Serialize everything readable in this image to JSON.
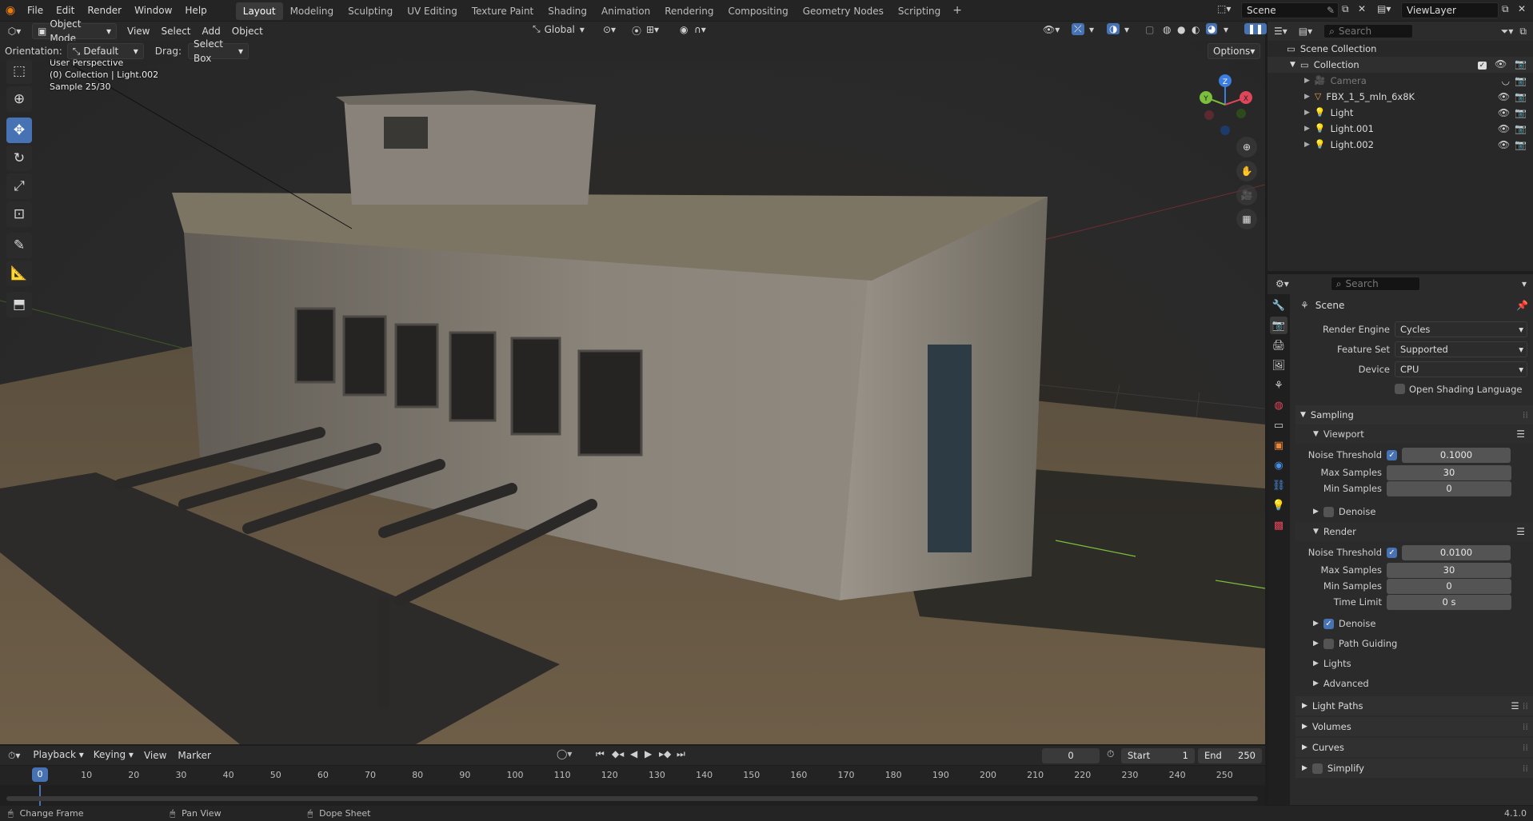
{
  "menubar": {
    "menus": [
      "File",
      "Edit",
      "Render",
      "Window",
      "Help"
    ],
    "workspaces": [
      "Layout",
      "Modeling",
      "Sculpting",
      "UV Editing",
      "Texture Paint",
      "Shading",
      "Animation",
      "Rendering",
      "Compositing",
      "Geometry Nodes",
      "Scripting"
    ],
    "active_workspace": "Layout",
    "scene": "Scene",
    "view_layer": "ViewLayer"
  },
  "viewport_header": {
    "mode": "Object Mode",
    "menus": [
      "View",
      "Select",
      "Add",
      "Object"
    ],
    "transform_orientation": "Global"
  },
  "tool_settings": {
    "orientation_label": "Orientation:",
    "orientation_value": "Default",
    "drag_label": "Drag:",
    "drag_value": "Select Box",
    "options_label": "Options"
  },
  "viewport_overlay": {
    "line1": "User Perspective",
    "line2": "(0) Collection | Light.002",
    "line3": "Sample 25/30"
  },
  "gizmo": {
    "z": "Z",
    "y": "Y",
    "x": "X"
  },
  "outliner": {
    "search_placeholder": "Search",
    "root": "Scene Collection",
    "collection": "Collection",
    "items": [
      {
        "name": "Camera",
        "icon": "camera-icon",
        "dim": true
      },
      {
        "name": "FBX_1_5_mln_6x8K",
        "icon": "mesh-icon",
        "dim": false
      },
      {
        "name": "Light",
        "icon": "light-icon",
        "dim": false
      },
      {
        "name": "Light.001",
        "icon": "light-icon",
        "dim": false
      },
      {
        "name": "Light.002",
        "icon": "light-icon",
        "dim": false
      }
    ]
  },
  "properties": {
    "search_placeholder": "Search",
    "context": "Scene",
    "render_engine_label": "Render Engine",
    "render_engine": "Cycles",
    "feature_set_label": "Feature Set",
    "feature_set": "Supported",
    "device_label": "Device",
    "device": "CPU",
    "osl_label": "Open Shading Language",
    "sampling": "Sampling",
    "viewport": "Viewport",
    "noise_threshold_label": "Noise Threshold",
    "max_samples_label": "Max Samples",
    "min_samples_label": "Min Samples",
    "time_limit_label": "Time Limit",
    "vp_noise_threshold": "0.1000",
    "vp_max_samples": "30",
    "vp_min_samples": "0",
    "denoise_label": "Denoise",
    "render": "Render",
    "r_noise_threshold": "0.0100",
    "r_max_samples": "30",
    "r_min_samples": "0",
    "r_time_limit": "0 s",
    "path_guiding": "Path Guiding",
    "lights": "Lights",
    "advanced": "Advanced",
    "light_paths": "Light Paths",
    "volumes": "Volumes",
    "curves": "Curves",
    "simplify": "Simplify"
  },
  "timeline": {
    "menus": [
      "Playback",
      "Keying",
      "View",
      "Marker"
    ],
    "current_frame": "0",
    "start_label": "Start",
    "start": "1",
    "end_label": "End",
    "end": "250",
    "ticks": [
      "0",
      "10",
      "20",
      "30",
      "40",
      "50",
      "60",
      "70",
      "80",
      "90",
      "100",
      "110",
      "120",
      "130",
      "140",
      "150",
      "160",
      "170",
      "180",
      "190",
      "200",
      "210",
      "220",
      "230",
      "240",
      "250"
    ]
  },
  "statusbar": {
    "left": "Change Frame",
    "middle": "Pan View",
    "right": "Dope Sheet",
    "version": "4.1.0"
  },
  "colors": {
    "accent": "#4772b3",
    "x_axis": "#e0465a",
    "y_axis": "#7bbf3d",
    "z_axis": "#3b7de0"
  }
}
